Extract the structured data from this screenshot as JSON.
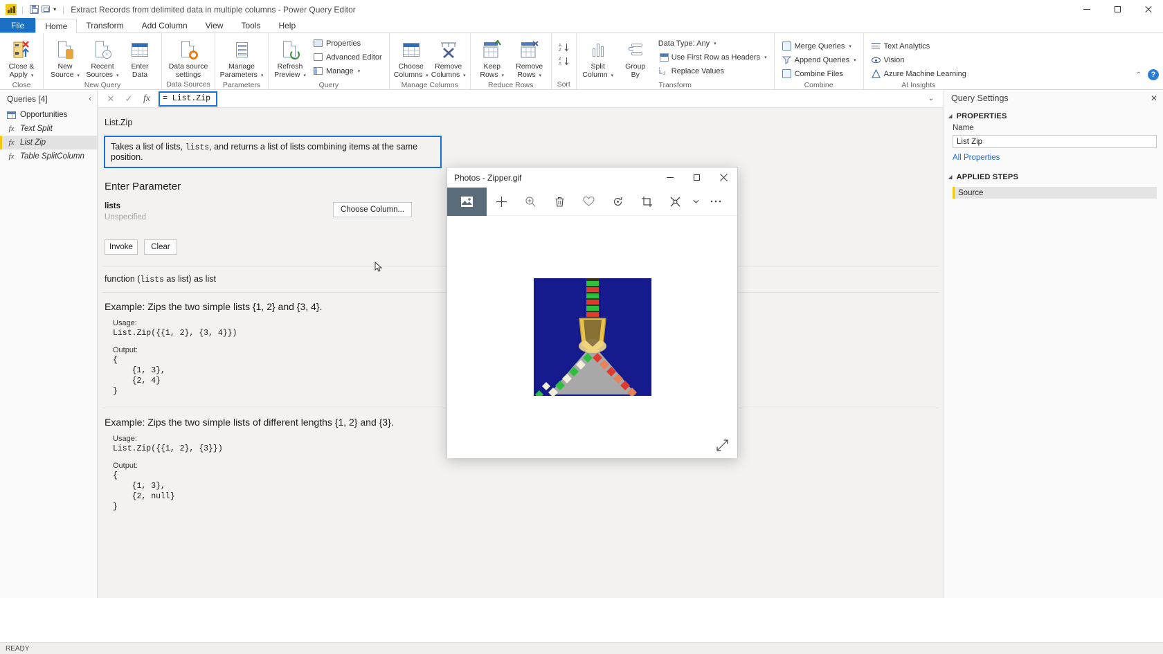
{
  "window": {
    "title": "Extract Records from delimited data in multiple columns - Power Query Editor",
    "app_icon": "power-bi-icon",
    "quick_access": [
      "save-icon",
      "undo-icon"
    ],
    "controls": {
      "minimize": "minimize-icon",
      "maximize": "maximize-icon",
      "close": "close-icon"
    }
  },
  "ribbon": {
    "tabs": [
      {
        "label": "File",
        "active": false,
        "file": true
      },
      {
        "label": "Home",
        "active": true
      },
      {
        "label": "Transform",
        "active": false
      },
      {
        "label": "Add Column",
        "active": false
      },
      {
        "label": "View",
        "active": false
      },
      {
        "label": "Tools",
        "active": false
      },
      {
        "label": "Help",
        "active": false
      }
    ],
    "groups": [
      {
        "label": "Close",
        "buttons": [
          {
            "label": "Close &\nApply",
            "caret": true
          }
        ]
      },
      {
        "label": "New Query",
        "buttons": [
          {
            "label": "New\nSource",
            "caret": true
          },
          {
            "label": "Recent\nSources",
            "caret": true
          },
          {
            "label": "Enter\nData",
            "caret": false
          }
        ]
      },
      {
        "label": "Data Sources",
        "buttons": [
          {
            "label": "Data source\nsettings",
            "caret": false
          }
        ]
      },
      {
        "label": "Parameters",
        "buttons": [
          {
            "label": "Manage\nParameters",
            "caret": true
          }
        ]
      },
      {
        "label": "Query",
        "buttons": [
          {
            "label": "Refresh\nPreview",
            "caret": true
          }
        ],
        "small": [
          {
            "label": "Properties",
            "icon": "properties-icon",
            "caret": false
          },
          {
            "label": "Advanced Editor",
            "icon": "advanced-editor-icon",
            "caret": false
          },
          {
            "label": "Manage",
            "icon": "manage-icon",
            "caret": true
          }
        ]
      },
      {
        "label": "Manage Columns",
        "buttons": [
          {
            "label": "Choose\nColumns",
            "caret": true
          },
          {
            "label": "Remove\nColumns",
            "caret": true
          }
        ]
      },
      {
        "label": "Reduce Rows",
        "buttons": [
          {
            "label": "Keep\nRows",
            "caret": true
          },
          {
            "label": "Remove\nRows",
            "caret": true
          }
        ]
      },
      {
        "label": "Sort",
        "small": [
          {
            "label": "",
            "icon": "sort-ascending-icon",
            "caret": false
          },
          {
            "label": "",
            "icon": "sort-descending-icon",
            "caret": false
          }
        ]
      },
      {
        "label": "Transform",
        "buttons": [
          {
            "label": "Split\nColumn",
            "caret": true
          },
          {
            "label": "Group\nBy",
            "caret": false
          }
        ],
        "small": [
          {
            "label": "Data Type: Any",
            "icon": "data-type-icon",
            "caret": true
          },
          {
            "label": "Use First Row as Headers",
            "icon": "first-row-headers-icon",
            "caret": true
          },
          {
            "label": "Replace Values",
            "icon": "replace-values-icon",
            "caret": false
          }
        ]
      },
      {
        "label": "Combine",
        "small": [
          {
            "label": "Merge Queries",
            "icon": "merge-queries-icon",
            "caret": true
          },
          {
            "label": "Append Queries",
            "icon": "append-queries-icon",
            "caret": true
          },
          {
            "label": "Combine Files",
            "icon": "combine-files-icon",
            "caret": false
          }
        ]
      },
      {
        "label": "AI Insights",
        "small": [
          {
            "label": "Text Analytics",
            "icon": "text-analytics-icon",
            "caret": false
          },
          {
            "label": "Vision",
            "icon": "vision-icon",
            "caret": false
          },
          {
            "label": "Azure Machine Learning",
            "icon": "azure-ml-icon",
            "caret": false
          }
        ]
      }
    ],
    "collapse_icon": "chevron-up-icon",
    "help_icon": "help-icon"
  },
  "queries_pane": {
    "title": "Queries [4]",
    "collapse_icon": "chevron-left-icon",
    "items": [
      {
        "label": "Opportunities",
        "icon": "table-icon",
        "selected": false,
        "kind": "table"
      },
      {
        "label": "Text Split",
        "icon": "function-icon",
        "selected": false,
        "kind": "function"
      },
      {
        "label": "List Zip",
        "icon": "function-icon",
        "selected": true,
        "kind": "function"
      },
      {
        "label": "Table SplitColumn",
        "icon": "function-icon",
        "selected": false,
        "kind": "function"
      }
    ]
  },
  "formula_bar": {
    "cancel_icon": "close-icon",
    "accept_icon": "check-icon",
    "fx_icon": "fx-icon",
    "value": "= List.Zip",
    "expand_icon": "chevron-down-icon",
    "highlighted": true
  },
  "function_pane": {
    "name": "List.Zip",
    "description": "Takes a list of lists, lists, and returns a list of lists combining items at the same position.",
    "description_pre": "Takes a list of lists, ",
    "description_mono": "lists",
    "description_post": ", and returns a list of lists combining items at the same position.",
    "parameter_heading": "Enter Parameter",
    "parameter_name": "lists",
    "parameter_value": "Unspecified",
    "choose_column_label": "Choose Column...",
    "invoke_label": "Invoke",
    "clear_label": "Clear",
    "signature_pre": "function (",
    "signature_mono": "lists",
    "signature_post": " as list) as list",
    "examples": [
      {
        "title": "Example: Zips the two simple lists {1, 2} and {3, 4}.",
        "usage_label": "Usage:",
        "usage_code": "List.Zip({{1, 2}, {3, 4}})",
        "output_label": "Output:",
        "output_code": "{\n    {1, 3},\n    {2, 4}\n}"
      },
      {
        "title": "Example: Zips the two simple lists of different lengths {1, 2} and {3}.",
        "usage_label": "Usage:",
        "usage_code": "List.Zip({{1, 2}, {3}})",
        "output_label": "Output:",
        "output_code": "{\n    {1, 3},\n    {2, null}\n}"
      }
    ]
  },
  "query_settings": {
    "title": "Query Settings",
    "close_icon": "close-icon",
    "properties_section": "PROPERTIES",
    "name_label": "Name",
    "name_value": "List Zip",
    "all_properties_link": "All Properties",
    "applied_steps_section": "APPLIED STEPS",
    "steps": [
      {
        "label": "Source",
        "selected": true
      }
    ]
  },
  "status_bar": {
    "text": "READY"
  },
  "photos_window": {
    "title": "Photos - Zipper.gif",
    "controls": {
      "minimize": "minimize-icon",
      "maximize": "maximize-icon",
      "close": "close-icon"
    },
    "toolbar": [
      {
        "icon": "image-icon",
        "active": true
      },
      {
        "icon": "plus-icon",
        "active": false
      },
      {
        "icon": "zoom-icon",
        "active": false
      },
      {
        "icon": "delete-icon",
        "active": false
      },
      {
        "icon": "heart-icon",
        "active": false
      },
      {
        "icon": "rotate-icon",
        "active": false
      },
      {
        "icon": "crop-icon",
        "active": false
      },
      {
        "icon": "edit-icon",
        "active": false
      },
      {
        "icon": "chevron-down-icon",
        "active": false
      },
      {
        "icon": "more-icon",
        "active": false
      }
    ],
    "expand_icon": "expand-icon",
    "image": {
      "name": "zipper-animation",
      "background_color": "#151b8d",
      "tooth_colors": [
        "#2fbf3f",
        "#e03a2f",
        "#f0f0d8"
      ],
      "pull_color": "#e8c24a",
      "fabric_color": "#a8a8a8"
    }
  },
  "colors": {
    "accent": "#1a6fd4",
    "file_tab": "#1a70c4",
    "selection_yellow": "#f2c811",
    "pane_bg": "#f3f2f0"
  }
}
